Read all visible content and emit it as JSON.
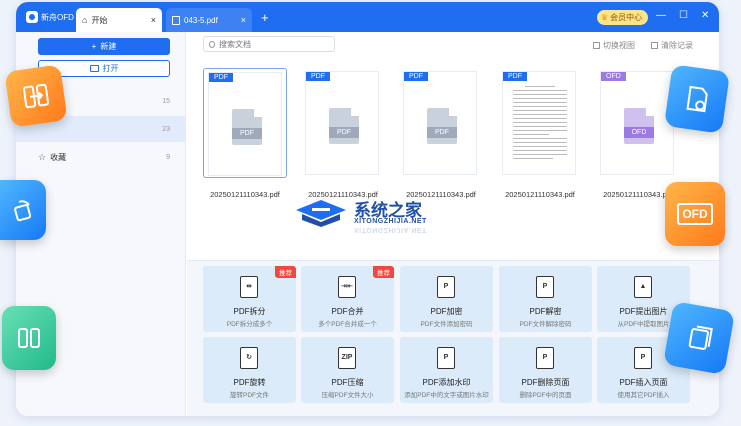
{
  "titlebar": {
    "app_name": "新舟OFD",
    "tabs": [
      {
        "label": "开始",
        "icon": "home-icon"
      },
      {
        "label": "043-5.pdf",
        "icon": "file-icon"
      }
    ],
    "vip_label": "会员中心",
    "window_controls": [
      "minimize",
      "maximize",
      "close"
    ]
  },
  "sidebar": {
    "new_label": "新建",
    "open_label": "打开",
    "items": [
      {
        "label": "",
        "count": "15"
      },
      {
        "label": "",
        "count": "23"
      },
      {
        "label": "收藏",
        "count": "9"
      }
    ]
  },
  "main": {
    "search_placeholder": "搜索文档",
    "toolbar": {
      "switch_view": "切换视图",
      "clear_history": "清除记录"
    },
    "files": [
      {
        "badge": "PDF",
        "name": "20250121110343.pdf",
        "type": "pdf"
      },
      {
        "badge": "PDF",
        "name": "20250121110343.pdf",
        "type": "pdf"
      },
      {
        "badge": "PDF",
        "name": "20250121110343.pdf",
        "type": "pdf"
      },
      {
        "badge": "PDF",
        "name": "20250121110343.pdf",
        "type": "text"
      },
      {
        "badge": "OFD",
        "name": "20250121110343.pdf",
        "type": "ofd"
      }
    ],
    "tools": [
      {
        "title": "PDF拆分",
        "desc": "PDF拆分成多个",
        "tag": "推荐",
        "icon": "split-icon"
      },
      {
        "title": "PDF合并",
        "desc": "多个PDF合并成一个",
        "tag": "推荐",
        "icon": "merge-icon"
      },
      {
        "title": "PDF加密",
        "desc": "PDF文件添加密码",
        "tag": "",
        "icon": "lock-icon"
      },
      {
        "title": "PDF解密",
        "desc": "PDF文件解除密码",
        "tag": "",
        "icon": "unlock-icon"
      },
      {
        "title": "PDF提出图片",
        "desc": "从PDF中提取图片",
        "tag": "",
        "icon": "image-icon"
      },
      {
        "title": "PDF旋转",
        "desc": "旋转PDF文件",
        "tag": "",
        "icon": "rotate-icon"
      },
      {
        "title": "PDF压缩",
        "desc": "压缩PDF文件大小",
        "tag": "",
        "icon": "zip-icon"
      },
      {
        "title": "PDF添加水印",
        "desc": "添加PDF中的文字或图片水印",
        "tag": "",
        "icon": "watermark-icon"
      },
      {
        "title": "PDF删除页面",
        "desc": "删除PDF中的页面",
        "tag": "",
        "icon": "delete-page-icon"
      },
      {
        "title": "PDF插入页面",
        "desc": "使用其它PDF插入",
        "tag": "",
        "icon": "insert-page-icon"
      }
    ]
  },
  "watermark": {
    "title": "系统之家",
    "subtitle": "XITONGZHIJIA.NET"
  },
  "float_badges": {
    "ofd": "OFD"
  },
  "colors": {
    "primary": "#1f6ef2",
    "ofd_accent": "#9c79e3",
    "tag_red": "#f0483e"
  }
}
